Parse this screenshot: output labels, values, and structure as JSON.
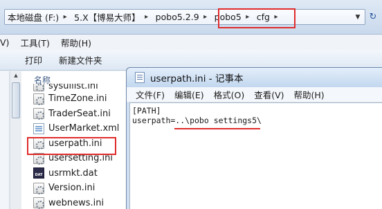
{
  "address_bar": {
    "breadcrumbs": [
      "本地磁盘 (F:)",
      "5.X【博易大师】",
      "pobo5.2.9",
      "pobo5",
      "cfg"
    ]
  },
  "explorer_menu": [
    "V)",
    "工具(T)",
    "帮助(H)"
  ],
  "explorer_toolbar": [
    "打印",
    "新建文件夹"
  ],
  "file_list": {
    "column_header": "名称",
    "files": [
      {
        "name": "sysuilist.ini",
        "icon": "ini-file-icon"
      },
      {
        "name": "TimeZone.ini",
        "icon": "ini-file-icon"
      },
      {
        "name": "TraderSeat.ini",
        "icon": "ini-file-icon"
      },
      {
        "name": "UserMarket.xml",
        "icon": "xml-file-icon"
      },
      {
        "name": "userpath.ini",
        "icon": "ini-file-icon",
        "highlighted": true
      },
      {
        "name": "usersetting.ini",
        "icon": "ini-file-icon"
      },
      {
        "name": "usrmkt.dat",
        "icon": "dat-file-icon",
        "icon_text": "DAT"
      },
      {
        "name": "Version.ini",
        "icon": "ini-file-icon"
      },
      {
        "name": "webnews.ini",
        "icon": "ini-file-icon"
      }
    ]
  },
  "notepad": {
    "title": "userpath.ini - 记事本",
    "menu": [
      "文件(F)",
      "编辑(E)",
      "格式(O)",
      "查看(V)",
      "帮助(H)"
    ],
    "lines": [
      "[PATH]",
      "userpath=..\\pobo settings5\\"
    ]
  },
  "colors": {
    "highlight": "#e02a2a"
  }
}
